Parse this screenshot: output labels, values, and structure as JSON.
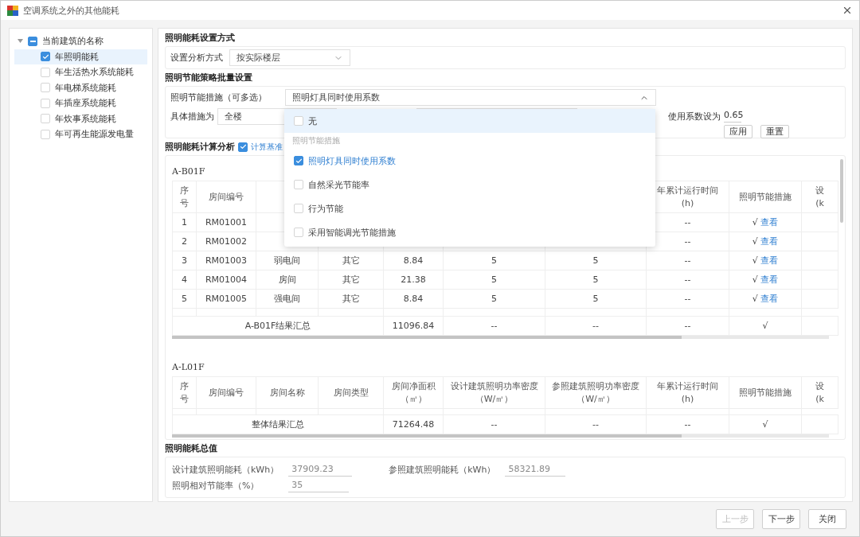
{
  "window": {
    "title": "空调系统之外的其他能耗"
  },
  "tree": {
    "label": "当前建筑的名称",
    "expanded": true,
    "indeterminate": true,
    "children": [
      {
        "label": "年照明能耗",
        "checked": true,
        "selected": true
      },
      {
        "label": "年生活热水系统能耗",
        "checked": false,
        "selected": false
      },
      {
        "label": "年电梯系统能耗",
        "checked": false,
        "selected": false
      },
      {
        "label": "年插座系统能耗",
        "checked": false,
        "selected": false
      },
      {
        "label": "年炊事系统能耗",
        "checked": false,
        "selected": false
      },
      {
        "label": "年可再生能源发电量",
        "checked": false,
        "selected": false
      }
    ]
  },
  "settings_mode": {
    "title": "照明能耗设置方式",
    "label": "设置分析方式",
    "value": "按实际楼层"
  },
  "batch": {
    "title": "照明节能策略批量设置",
    "measure_label": "照明节能措施（可多选）",
    "measure_value": "照明灯具同时使用系数",
    "scope_label": "具体措施为",
    "scope_value": "全楼",
    "coef_label": "使用系数设为",
    "coef_value": "0.65",
    "buttons": [
      "应用",
      "重置"
    ]
  },
  "analysis": {
    "title": "照明能耗计算分析",
    "checkbox": {
      "label": "计算基准",
      "checked": true
    }
  },
  "tables": [
    {
      "title": "A-B01F",
      "columns": [
        {
          "label": "序号"
        },
        {
          "label": "房间编号"
        },
        {},
        {},
        {},
        {},
        {},
        {
          "label": "年累计运行时间(h)"
        },
        {
          "label": "照明节能措施"
        },
        {
          "label": "设(k"
        }
      ],
      "rows": [
        {
          "cells": [
            "1",
            "RM01001",
            null,
            null,
            null,
            null,
            null,
            "--"
          ],
          "mark": "√",
          "link": "查看"
        },
        {
          "cells": [
            "2",
            "RM01002",
            null,
            null,
            null,
            null,
            null,
            "--"
          ],
          "mark": "√",
          "link": "查看"
        },
        {
          "cells": [
            "3",
            "RM01003",
            "弱电间",
            "其它",
            "8.84",
            "5",
            "5",
            "--"
          ],
          "mark": "√",
          "link": "查看"
        },
        {
          "cells": [
            "4",
            "RM01004",
            "房间",
            "其它",
            "21.38",
            "5",
            "5",
            "--"
          ],
          "mark": "√",
          "link": "查看"
        },
        {
          "cells": [
            "5",
            "RM01005",
            "强电间",
            "其它",
            "8.84",
            "5",
            "5",
            "--"
          ],
          "mark": "√",
          "link": "查看"
        }
      ],
      "summary": {
        "label": "A-B01F结果汇总",
        "cells": [
          "11096.84",
          "--",
          "--",
          "--",
          "√"
        ]
      }
    },
    {
      "title": "A-L01F",
      "columns": [
        {
          "label": "序号"
        },
        {
          "label": "房间编号"
        },
        {
          "label": "房间名称"
        },
        {
          "label": "房间类型"
        },
        {
          "label": "房间净面积（㎡）"
        },
        {
          "label": "设计建筑照明功率密度（W/㎡）"
        },
        {
          "label": "参照建筑照明功率密度（W/㎡）"
        },
        {
          "label": "年累计运行时间(h)"
        },
        {
          "label": "照明节能措施"
        },
        {
          "label": "设(k"
        }
      ],
      "summary": {
        "label": "整体结果汇总",
        "cells": [
          "71264.48",
          "--",
          "--",
          "--",
          "√"
        ]
      }
    }
  ],
  "totals": {
    "title": "照明能耗总值",
    "fields": [
      {
        "label": "设计建筑照明能耗（kWh）",
        "value": "37909.23"
      },
      {
        "label": "参照建筑照明能耗（kWh）",
        "value": "58321.89"
      },
      {
        "label": "照明相对节能率（%）",
        "value": "35"
      }
    ]
  },
  "dropdown": {
    "items": [
      {
        "kind": "option",
        "label": "无",
        "checked": false,
        "highlighted": true
      },
      {
        "kind": "group",
        "label": "照明节能措施"
      },
      {
        "kind": "option",
        "label": "照明灯具同时使用系数",
        "checked": true,
        "highlighted": false
      },
      {
        "kind": "option",
        "label": "自然采光节能率",
        "checked": false,
        "highlighted": false
      },
      {
        "kind": "option",
        "label": "行为节能",
        "checked": false,
        "highlighted": false
      },
      {
        "kind": "option",
        "label": "采用智能调光节能措施",
        "checked": false,
        "highlighted": false
      }
    ]
  },
  "footer_buttons": [
    {
      "label": "上一步",
      "disabled": true
    },
    {
      "label": "下一步",
      "disabled": false
    },
    {
      "label": "关闭",
      "disabled": false
    }
  ]
}
